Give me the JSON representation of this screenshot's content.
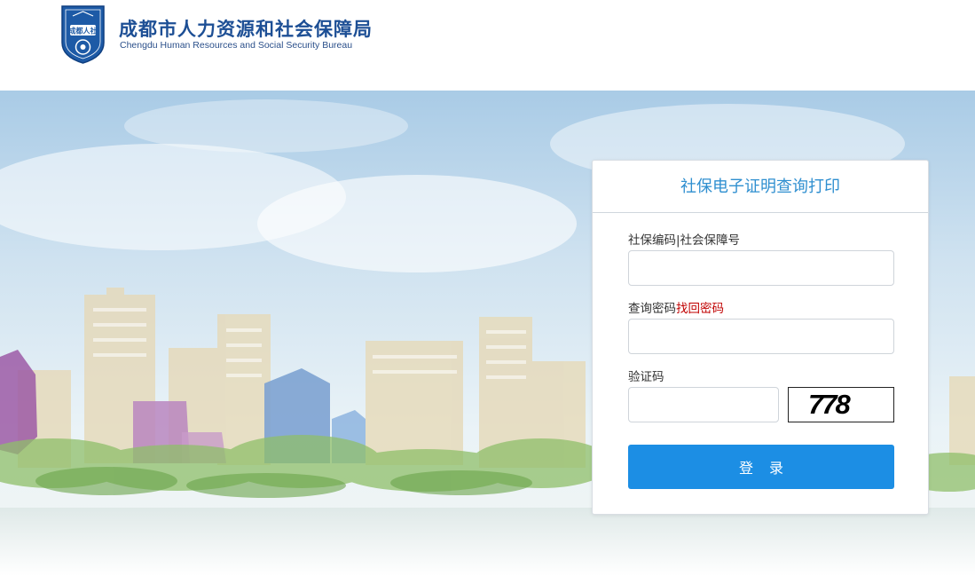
{
  "header": {
    "title": "成都市人力资源和社会保障局",
    "subtitle": "Chengdu Human Resources and Social Security Bureau",
    "emblem_text": "成都人社"
  },
  "login": {
    "title": "社保电子证明查询打印",
    "code_label": "社保编码|社会保障号",
    "code_value": "",
    "password_label": "查询密码",
    "forgot_link": "找回密码",
    "password_value": "",
    "captcha_label": "验证码",
    "captcha_value": "",
    "captcha_image_text": "778",
    "submit_label": "登录"
  },
  "colors": {
    "brand_blue": "#1d4f95",
    "title_blue": "#2f8fd0",
    "button_blue": "#1c8ee4",
    "link_red": "#c00000"
  },
  "icons": [
    "logo-emblem-icon"
  ]
}
